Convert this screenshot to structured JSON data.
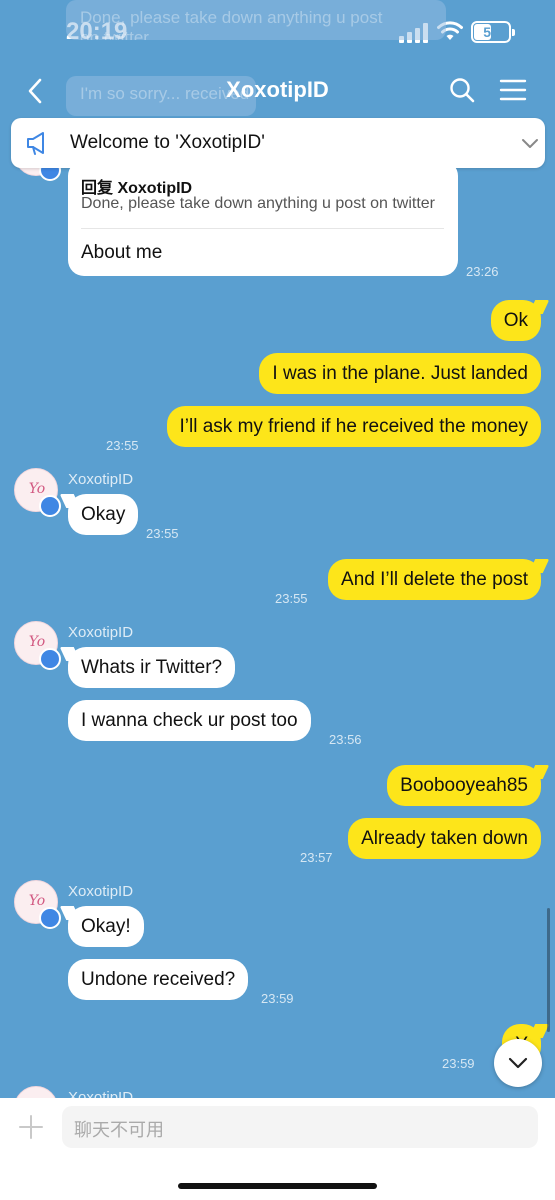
{
  "status_bar": {
    "time": "20:19",
    "battery": "50"
  },
  "background_ghost": {
    "line1": "Done, please take down anything u post",
    "line2": "on twitter",
    "line3": "I'm so sorry... received"
  },
  "header": {
    "title": "XoxotipID"
  },
  "announcement": {
    "text": "Welcome to 'XoxotipID'"
  },
  "reply_card": {
    "title": "回复 XoxotipID",
    "quote": "Done, please take down anything u post on twitter",
    "message": "About me",
    "time": "23:26"
  },
  "messages": [
    {
      "side": "right",
      "text": "Ok"
    },
    {
      "side": "right",
      "text": "I was in the plane. Just landed"
    },
    {
      "side": "right",
      "text": "I’ll ask my friend if he received the money",
      "time": "23:55"
    },
    {
      "side": "left",
      "sender": "XoxotipID",
      "text": "Okay",
      "time": "23:55"
    },
    {
      "side": "right",
      "text": "And I’ll delete the post",
      "time": "23:55"
    },
    {
      "side": "left",
      "sender": "XoxotipID",
      "text": "Whats ir Twitter?"
    },
    {
      "side": "left",
      "text": "I wanna check ur post too",
      "time": "23:56"
    },
    {
      "side": "right",
      "text": "Boobooyeah85"
    },
    {
      "side": "right",
      "text": "Already taken down",
      "time": "23:57"
    },
    {
      "side": "left",
      "sender": "XoxotipID",
      "text": "Okay!"
    },
    {
      "side": "left",
      "text": "Undone received?",
      "time": "23:59"
    },
    {
      "side": "right",
      "text": "Y",
      "time": "23:59"
    },
    {
      "side": "left",
      "sender": "XoxotipID"
    }
  ],
  "avatar_monogram": "Yo",
  "input": {
    "placeholder": "聊天不可用"
  },
  "colors": {
    "background": "#5a9fd0",
    "outgoing_bubble": "#fde51a",
    "incoming_bubble": "#ffffff"
  }
}
